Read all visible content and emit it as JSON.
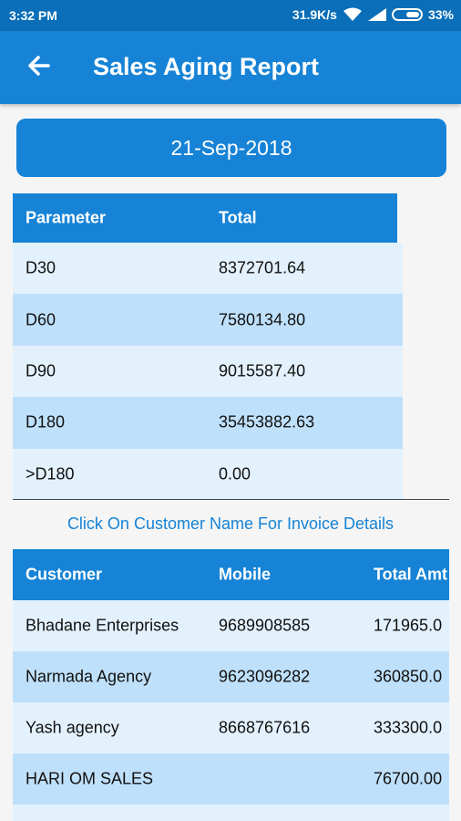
{
  "status": {
    "time": "3:32 PM",
    "speed": "31.9K/s",
    "battery": "33%"
  },
  "appbar": {
    "title": "Sales Aging Report",
    "back_icon": "arrow-left-icon"
  },
  "date_button": "21-Sep-2018",
  "param_table": {
    "headers": [
      "Parameter",
      "Total"
    ],
    "rows": [
      [
        "D30",
        "8372701.64"
      ],
      [
        "D60",
        "7580134.80"
      ],
      [
        "D90",
        "9015587.40"
      ],
      [
        "D180",
        "35453882.63"
      ],
      [
        ">D180",
        "0.00"
      ]
    ]
  },
  "hint": "Click On Customer Name For Invoice Details",
  "customer_table": {
    "headers": [
      "Customer",
      "Mobile",
      "Total Amt"
    ],
    "rows": [
      [
        "Bhadane Enterprises",
        "9689908585",
        "171965.0"
      ],
      [
        "Narmada Agency",
        "9623096282",
        "360850.0"
      ],
      [
        "Yash agency",
        "8668767616",
        "333300.0"
      ],
      [
        "HARI OM SALES",
        "",
        "76700.00"
      ]
    ]
  },
  "colors": {
    "primary": "#1683d6",
    "statusbar": "#0a6fb8",
    "row_light": "#e3f1fd",
    "row_dark": "#bfe0fb"
  }
}
